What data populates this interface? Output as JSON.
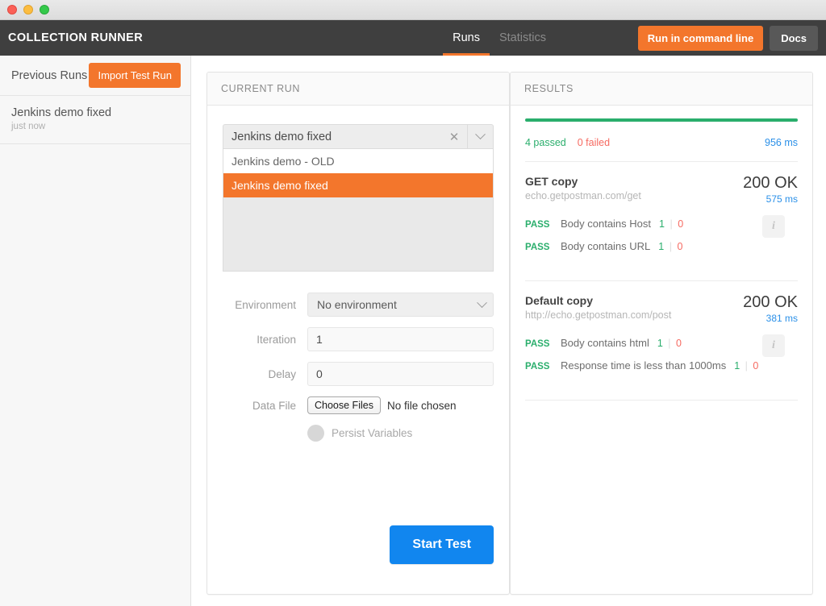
{
  "window": {
    "lights": [
      "close-red",
      "minimize-yellow",
      "maximize-green"
    ]
  },
  "header": {
    "title": "COLLECTION RUNNER",
    "tabs": [
      {
        "label": "Runs",
        "active": true
      },
      {
        "label": "Statistics",
        "active": false
      }
    ],
    "run_in_command_line_label": "Run in command line",
    "docs_label": "Docs",
    "accent_color": "#f3762c",
    "bg_color": "#3f3f3f"
  },
  "sidebar": {
    "heading": "Previous Runs",
    "import_label": "Import Test Run",
    "runs": [
      {
        "name": "Jenkins demo fixed",
        "time": "just now"
      }
    ]
  },
  "current_run": {
    "panel_title": "CURRENT RUN",
    "collection": {
      "selected": "Jenkins demo fixed",
      "clear_icon": "close-icon",
      "arrow_icon": "chevron-down-icon",
      "options": [
        {
          "label": "Jenkins demo - OLD",
          "selected": false
        },
        {
          "label": "Jenkins demo fixed",
          "selected": true
        }
      ]
    },
    "fields": {
      "environment_label": "Environment",
      "environment_value": "No environment",
      "iteration_label": "Iteration",
      "iteration_value": "1",
      "delay_label": "Delay",
      "delay_value": "0",
      "data_file_label": "Data File",
      "choose_files_label": "Choose Files",
      "no_file_text": "No file chosen",
      "persist_variables_label": "Persist Variables"
    },
    "start_label": "Start Test",
    "start_color": "#1186ef"
  },
  "results": {
    "panel_title": "RESULTS",
    "summary": {
      "passed": "4 passed",
      "failed": "0 failed",
      "total_time": "956 ms",
      "bar_color": "#2aae6c"
    },
    "blocks": [
      {
        "request_name": "GET copy",
        "url": "echo.getpostman.com/get",
        "status": "200 OK",
        "time": "575 ms",
        "info_icon": "info-icon",
        "tests": [
          {
            "result": "PASS",
            "name": "Body contains Host",
            "pass": "1",
            "fail": "0"
          },
          {
            "result": "PASS",
            "name": "Body contains URL",
            "pass": "1",
            "fail": "0"
          }
        ]
      },
      {
        "request_name": "Default copy",
        "url": "http://echo.getpostman.com/post",
        "status": "200 OK",
        "time": "381 ms",
        "info_icon": "info-icon",
        "tests": [
          {
            "result": "PASS",
            "name": "Body contains html",
            "pass": "1",
            "fail": "0"
          },
          {
            "result": "PASS",
            "name": "Response time is less than 1000ms",
            "pass": "1",
            "fail": "0"
          }
        ]
      }
    ]
  }
}
